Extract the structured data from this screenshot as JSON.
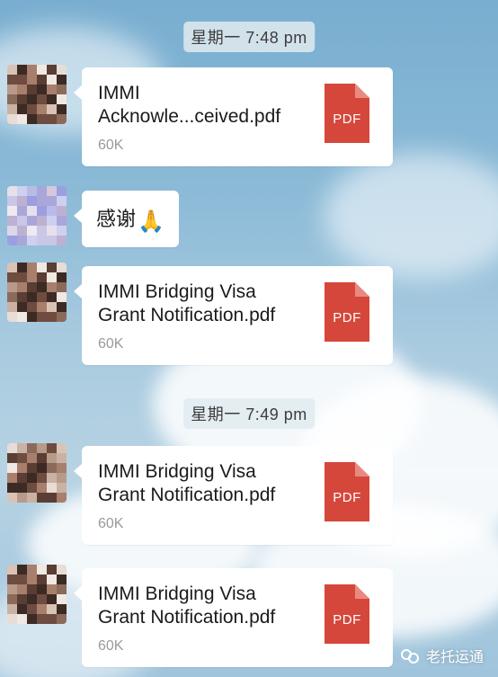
{
  "messages": [
    {
      "type": "time",
      "text": "星期一 7:48 pm"
    },
    {
      "type": "file",
      "sender": "contact",
      "name": "IMMI\nAcknowle...ceived.pdf",
      "size": "60K",
      "icon": "pdf-icon",
      "icon_label": "PDF"
    },
    {
      "type": "text",
      "sender": "me",
      "text": "感谢",
      "emoji": "🙏"
    },
    {
      "type": "file",
      "sender": "contact",
      "name": "IMMI Bridging Visa Grant Notification.pdf",
      "size": "60K",
      "icon": "pdf-icon",
      "icon_label": "PDF"
    },
    {
      "type": "time",
      "text": "星期一 7:49 pm"
    },
    {
      "type": "file",
      "sender": "contact",
      "name": "IMMI Bridging Visa Grant Notification.pdf",
      "size": "60K",
      "icon": "pdf-icon",
      "icon_label": "PDF"
    },
    {
      "type": "file",
      "sender": "contact",
      "name": "IMMI Bridging Visa Grant Notification.pdf",
      "size": "60K",
      "icon": "pdf-icon",
      "icon_label": "PDF"
    }
  ],
  "watermark": {
    "text": "老托运通",
    "icon": "wechat-channel-icon"
  },
  "colors": {
    "pdf": "#d6473b",
    "bubble": "#ffffff",
    "timestamp_bg": "#e1ebf0"
  }
}
